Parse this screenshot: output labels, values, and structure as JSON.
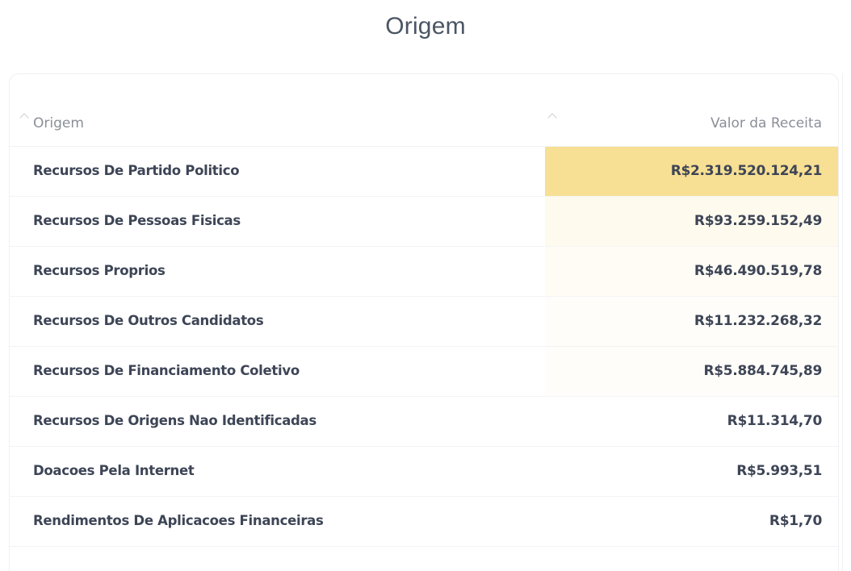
{
  "page": {
    "title": "Origem"
  },
  "table": {
    "columns": {
      "origem": "Origem",
      "valor": "Valor da Receita"
    },
    "highlight_color": "#f7df93",
    "rows": [
      {
        "origem": "Recursos De Partido Politico",
        "valor": "R$2.319.520.124,21",
        "intensity": 1.0
      },
      {
        "origem": "Recursos De Pessoas Fisicas",
        "valor": "R$93.259.152,49",
        "intensity": 0.04
      },
      {
        "origem": "Recursos Proprios",
        "valor": "R$46.490.519,78",
        "intensity": 0.02
      },
      {
        "origem": "Recursos De Outros Candidatos",
        "valor": "R$11.232.268,32",
        "intensity": 0.005
      },
      {
        "origem": "Recursos De Financiamento Coletivo",
        "valor": "R$5.884.745,89",
        "intensity": 0.0025
      },
      {
        "origem": "Recursos De Origens Nao Identificadas",
        "valor": "R$11.314,70",
        "intensity": 0.0
      },
      {
        "origem": "Doacoes Pela Internet",
        "valor": "R$5.993,51",
        "intensity": 0.0
      },
      {
        "origem": "Rendimentos De Aplicacoes Financeiras",
        "valor": "R$1,70",
        "intensity": 0.0
      }
    ]
  }
}
